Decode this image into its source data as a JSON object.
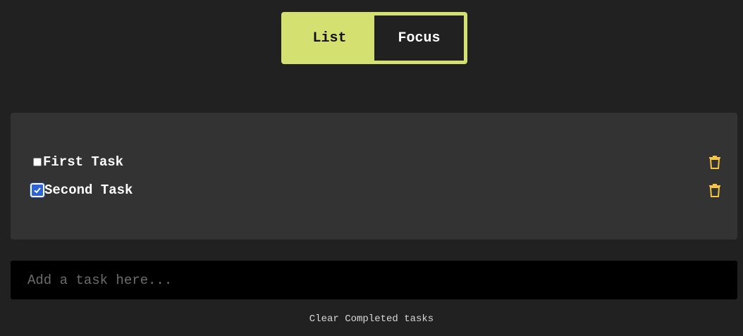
{
  "view_toggle": {
    "list_label": "List",
    "focus_label": "Focus",
    "active": "Focus"
  },
  "tasks": [
    {
      "label": "First Task",
      "completed": false
    },
    {
      "label": "Second Task",
      "completed": true
    }
  ],
  "new_task": {
    "placeholder": "Add a task here...",
    "value": ""
  },
  "footer": {
    "clear_label": "Clear Completed tasks"
  },
  "colors": {
    "accent": "#d4e06f",
    "background": "#212121",
    "panel": "#333333",
    "trash_icon": "#f5c542",
    "checkbox_checked": "#2c64d8"
  },
  "icons": {
    "delete": "trash-icon",
    "checked": "checkmark-icon"
  }
}
